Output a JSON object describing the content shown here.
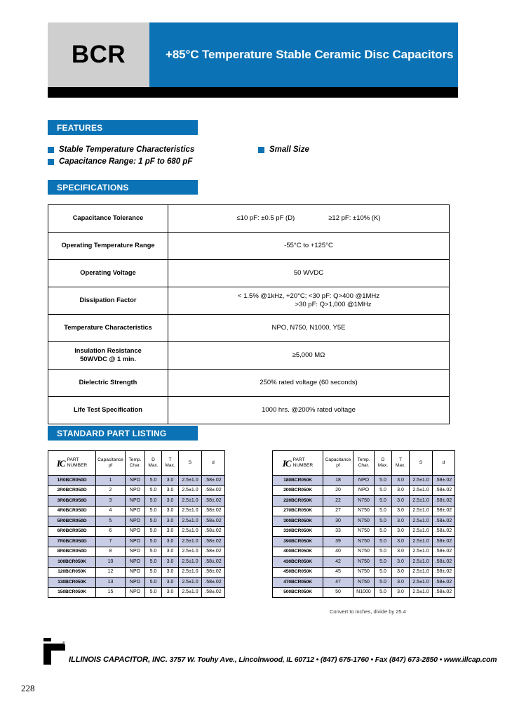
{
  "header": {
    "product_code": "BCR",
    "title": "+85°C Temperature Stable Ceramic Disc Capacitors"
  },
  "sections": {
    "features": "FEATURES",
    "specifications": "SPECIFICATIONS",
    "standard_part_listing": "STANDARD PART LISTING"
  },
  "features": {
    "left": [
      "Stable Temperature Characteristics",
      "Capacitance Range: 1 pF to 680 pF"
    ],
    "right": [
      "Small Size"
    ]
  },
  "specifications": [
    {
      "label": "Capacitance Tolerance",
      "value_a": "≤10 pF: ±0.5 pF (D)",
      "value_b": "≥12 pF: ±10% (K)"
    },
    {
      "label": "Operating Temperature Range",
      "value_a": "-55°C to +125°C"
    },
    {
      "label": "Operating Voltage",
      "value_a": "50 WVDC"
    },
    {
      "label": "Dissipation Factor",
      "value_a": "< 1.5%  @1kHz, +20°C; <30 pF: Q>400 @1MHz",
      "value_b": ">30 pF: Q>1,000 @1MHz"
    },
    {
      "label": "Temperature Characteristics",
      "value_a": "NPO, N750, N1000, Y5E"
    },
    {
      "label": "Insulation Resistance",
      "label2": "50WVDC @ 1 min.",
      "value_a": "≥5,000 MΩ"
    },
    {
      "label": "Dielectric Strength",
      "value_a": "250% rated voltage (60 seconds)"
    },
    {
      "label": "Life Test Specification",
      "value_a": "1000 hrs. @200% rated voltage"
    }
  ],
  "parts": {
    "headers": {
      "part_number_line1": "PART",
      "part_number_line2": "NUMBER",
      "ic_logo": "IC",
      "capacitance_line1": "Capacitance",
      "capacitance_line2": "pf",
      "temp_char_line1": "Temp.",
      "temp_char_line2": "Char.",
      "d_line1": "D",
      "d_line2": "Max.",
      "t_line1": "T",
      "t_line2": "Max.",
      "s": "S",
      "d_small": "d"
    },
    "left_rows": [
      {
        "pn": "1R0BCR050D",
        "cap": "1",
        "tc": "NPO",
        "d": "5.0",
        "t": "3.0",
        "s": "2.5±1.0",
        "dd": ".58±.02"
      },
      {
        "pn": "2R0BCR050D",
        "cap": "2",
        "tc": "NPO",
        "d": "5.0",
        "t": "3.0",
        "s": "2.5±1.0",
        "dd": ".58±.02"
      },
      {
        "pn": "3R0BCR050D",
        "cap": "3",
        "tc": "NPO",
        "d": "5.0",
        "t": "3.0",
        "s": "2.5±1.0",
        "dd": ".58±.02"
      },
      {
        "pn": "4R0BCR050D",
        "cap": "4",
        "tc": "NPO",
        "d": "5.0",
        "t": "3.0",
        "s": "2.5±1.0",
        "dd": ".58±.02"
      },
      {
        "pn": "5R0BCR050D",
        "cap": "5",
        "tc": "NPO",
        "d": "5.0",
        "t": "3.0",
        "s": "2.5±1.0",
        "dd": ".58±.02"
      },
      {
        "pn": "6R0BCR050D",
        "cap": "6",
        "tc": "NPO",
        "d": "5.0",
        "t": "3.0",
        "s": "2.5±1.0",
        "dd": ".58±.02"
      },
      {
        "pn": "7R0BCR050D",
        "cap": "7",
        "tc": "NPO",
        "d": "5.0",
        "t": "3.0",
        "s": "2.5±1.0",
        "dd": ".58±.02"
      },
      {
        "pn": "8R0BCR050D",
        "cap": "8",
        "tc": "NPO",
        "d": "5.0",
        "t": "3.0",
        "s": "2.5±1.0",
        "dd": ".58±.02"
      },
      {
        "pn": "100BCR050K",
        "cap": "10",
        "tc": "NPO",
        "d": "5.0",
        "t": "3.0",
        "s": "2.5±1.0",
        "dd": ".58±.02"
      },
      {
        "pn": "120BCR050K",
        "cap": "12",
        "tc": "NPO",
        "d": "5.0",
        "t": "3.0",
        "s": "2.5±1.0",
        "dd": ".58±.02"
      },
      {
        "pn": "130BCR050K",
        "cap": "13",
        "tc": "NPO",
        "d": "5.0",
        "t": "3.0",
        "s": "2.5±1.0",
        "dd": ".58±.02"
      },
      {
        "pn": "150BCR050K",
        "cap": "15",
        "tc": "NPO",
        "d": "5.0",
        "t": "3.0",
        "s": "2.5±1.0",
        "dd": ".58±.02"
      }
    ],
    "right_rows": [
      {
        "pn": "180BCR050K",
        "cap": "18",
        "tc": "NPO",
        "d": "5.0",
        "t": "3.0",
        "s": "2.5±1.0",
        "dd": ".58±.02"
      },
      {
        "pn": "200BCR050K",
        "cap": "20",
        "tc": "NPO",
        "d": "5.0",
        "t": "3.0",
        "s": "2.5±1.0",
        "dd": ".58±.02"
      },
      {
        "pn": "220BCR050K",
        "cap": "22",
        "tc": "N750",
        "d": "5.0",
        "t": "3.0",
        "s": "2.5±1.0",
        "dd": ".58±.02"
      },
      {
        "pn": "270BCR050K",
        "cap": "27",
        "tc": "N750",
        "d": "5.0",
        "t": "3.0",
        "s": "2.5±1.0",
        "dd": ".58±.02"
      },
      {
        "pn": "300BCR050K",
        "cap": "30",
        "tc": "N750",
        "d": "5.0",
        "t": "3.0",
        "s": "2.5±1.0",
        "dd": ".58±.02"
      },
      {
        "pn": "330BCR050K",
        "cap": "33",
        "tc": "N750",
        "d": "5.0",
        "t": "3.0",
        "s": "2.5±1.0",
        "dd": ".58±.02"
      },
      {
        "pn": "390BCR050K",
        "cap": "39",
        "tc": "N750",
        "d": "5.0",
        "t": "3.0",
        "s": "2.5±1.0",
        "dd": ".58±.02"
      },
      {
        "pn": "400BCR050K",
        "cap": "40",
        "tc": "N750",
        "d": "5.0",
        "t": "3.0",
        "s": "2.5±1.0",
        "dd": ".58±.02"
      },
      {
        "pn": "430BCR050K",
        "cap": "42",
        "tc": "N750",
        "d": "5.0",
        "t": "3.0",
        "s": "2.5±1.0",
        "dd": ".58±.02"
      },
      {
        "pn": "450BCR050K",
        "cap": "45",
        "tc": "N750",
        "d": "5.0",
        "t": "3.0",
        "s": "2.5±1.0",
        "dd": ".58±.02"
      },
      {
        "pn": "470BCR050K",
        "cap": "47",
        "tc": "N750",
        "d": "5.0",
        "t": "3.0",
        "s": "2.5±1.0",
        "dd": ".58±.02"
      },
      {
        "pn": "500BCR050K",
        "cap": "50",
        "tc": "N1000",
        "d": "5.0",
        "t": "3.0",
        "s": "2.5±1.0",
        "dd": ".58±.02"
      }
    ],
    "convert_note": "Convert to inches, divide by 25.4"
  },
  "footer": {
    "company": "ILLINOIS CAPACITOR, INC.",
    "address": "3757 W. Touhy Ave., Lincolnwood, IL 60712 • (847) 675-1760 • Fax (847) 673-2850 • www.illcap.com",
    "page_number": "228"
  },
  "colors": {
    "brand_blue": "#0a72b5",
    "logo_gray": "#cfcfcf",
    "row_shade": "#c8cce4"
  }
}
